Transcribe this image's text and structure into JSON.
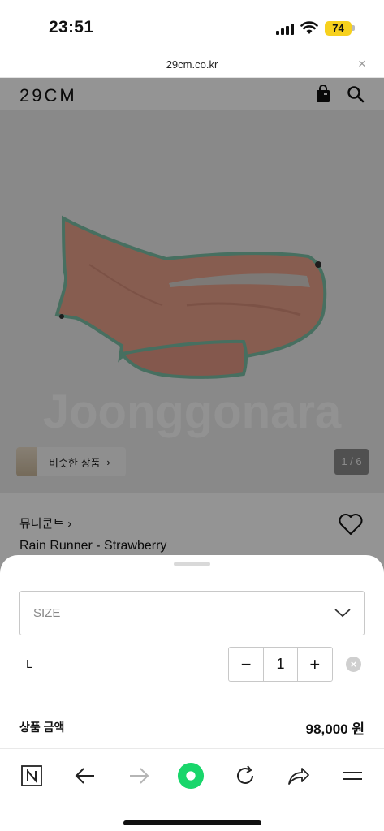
{
  "status_bar": {
    "time": "23:51",
    "battery": "74"
  },
  "url_bar": {
    "url": "29cm.co.kr",
    "close": "×"
  },
  "site": {
    "logo": "29CM"
  },
  "product": {
    "watermark": "Joonggonara",
    "similar_label": "비슷한 상품",
    "similar_arrow": "›",
    "image_counter": "1 / 6",
    "brand": "뮤니쿤트",
    "brand_arrow": "›",
    "name": "Rain Runner - Strawberry"
  },
  "sheet": {
    "size_placeholder": "SIZE",
    "option_name": "L",
    "minus": "−",
    "quantity": "1",
    "plus": "+",
    "remove": "×",
    "price_label": "상품 금액",
    "price_value": "98,000 원"
  },
  "icons": {
    "bag": "shopping-bag-icon",
    "search": "search-icon",
    "heart": "heart-icon",
    "chevron": "chevron-down-icon"
  },
  "colors": {
    "product_coat": "#e8a08a",
    "trim": "#7bbfa6",
    "battery": "#f7d11e",
    "accent_green": "#19d66b"
  }
}
